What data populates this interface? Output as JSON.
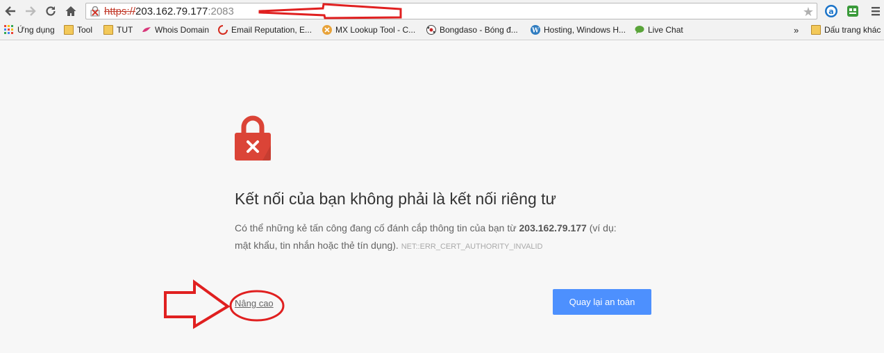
{
  "browser": {
    "url": {
      "scheme": "https://",
      "host": "203.162.79.177",
      "port": ":2083"
    },
    "bookmarks": [
      {
        "label": "Ứng dụng",
        "icon": "apps-grid-icon"
      },
      {
        "label": "Tool",
        "icon": "folder-icon"
      },
      {
        "label": "TUT",
        "icon": "folder-icon"
      },
      {
        "label": "Whois Domain",
        "icon": "whois-icon"
      },
      {
        "label": "Email Reputation, E...",
        "icon": "email-reputation-icon"
      },
      {
        "label": "MX Lookup Tool - C...",
        "icon": "mx-lookup-icon"
      },
      {
        "label": "Bongdaso - Bóng đ...",
        "icon": "bongdaso-icon"
      },
      {
        "label": "Hosting, Windows H...",
        "icon": "wordpress-icon"
      },
      {
        "label": "Live Chat",
        "icon": "chat-icon"
      }
    ],
    "overflow": "»",
    "other_bookmarks": "Dấu trang khác"
  },
  "error_page": {
    "heading": "Kết nối của bạn không phải là kết nối riêng tư",
    "desc_before": "Có thể những kẻ tấn công đang cố đánh cắp thông tin của bạn từ ",
    "desc_host": "203.162.79.177",
    "desc_after": " (ví dụ: mật khẩu, tin nhắn hoặc thẻ tín dụng). ",
    "error_code": "NET::ERR_CERT_AUTHORITY_INVALID",
    "advanced_link": "Nâng cao",
    "back_button": "Quay lại an toàn"
  },
  "colors": {
    "lock_red": "#db4437",
    "button_blue": "#4d90fe",
    "annotation_red": "#e02020"
  }
}
